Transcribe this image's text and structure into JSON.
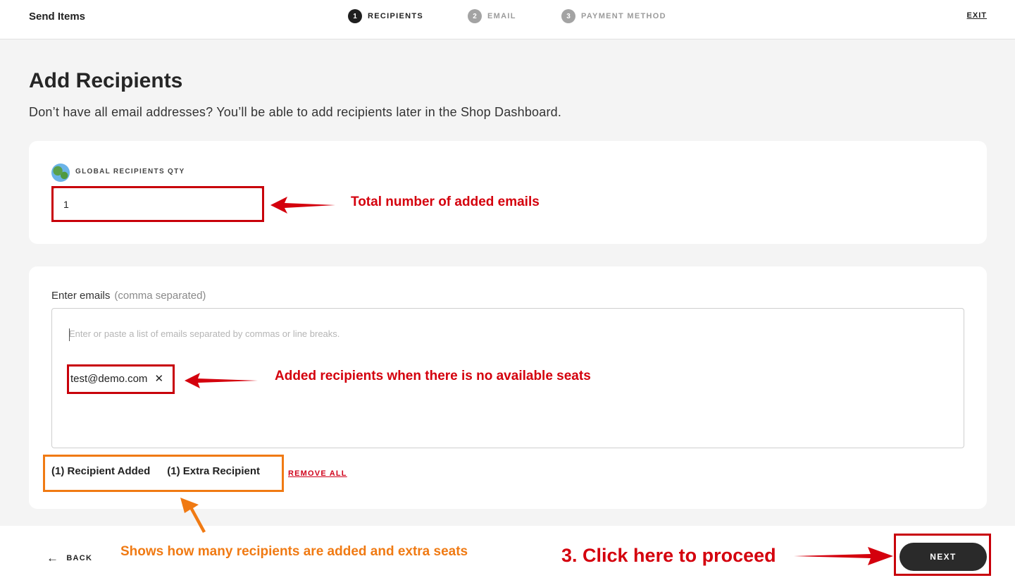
{
  "header": {
    "title": "Send Items",
    "steps": [
      {
        "number": "1",
        "label": "RECIPIENTS",
        "active": true
      },
      {
        "number": "2",
        "label": "EMAIL",
        "active": false
      },
      {
        "number": "3",
        "label": "PAYMENT METHOD",
        "active": false
      }
    ],
    "exit_label": "EXIT"
  },
  "main": {
    "title": "Add Recipients",
    "subtitle": "Don’t have all email addresses? You’ll be able to add recipients later in the Shop Dashboard.",
    "qty": {
      "icon": "globe-icon",
      "label": "GLOBAL RECIPIENTS QTY",
      "value": "1"
    },
    "emails": {
      "label": "Enter emails",
      "hint": "(comma separated)",
      "placeholder": "Enter or paste a list of emails separated by commas or line breaks.",
      "chips": [
        "test@demo.com"
      ],
      "chip_close_icon": "close-icon"
    },
    "counts": {
      "added": "(1) Recipient Added",
      "extra": "(1) Extra Recipient"
    },
    "remove_all_label": "REMOVE ALL"
  },
  "footer": {
    "back_label": "BACK",
    "back_icon": "arrow-left-icon",
    "next_label": "NEXT"
  },
  "annotations": {
    "qty_note": "Total number of added emails",
    "chip_note": "Added recipients when there is no available seats",
    "counts_note": "Shows how many recipients are added and extra seats",
    "next_note": "3. Click here to proceed"
  },
  "colors": {
    "annotation_red": "#c8000a",
    "annotation_orange": "#f07a13",
    "link_red": "#d0021b",
    "button_dark": "#2a2a2a"
  }
}
